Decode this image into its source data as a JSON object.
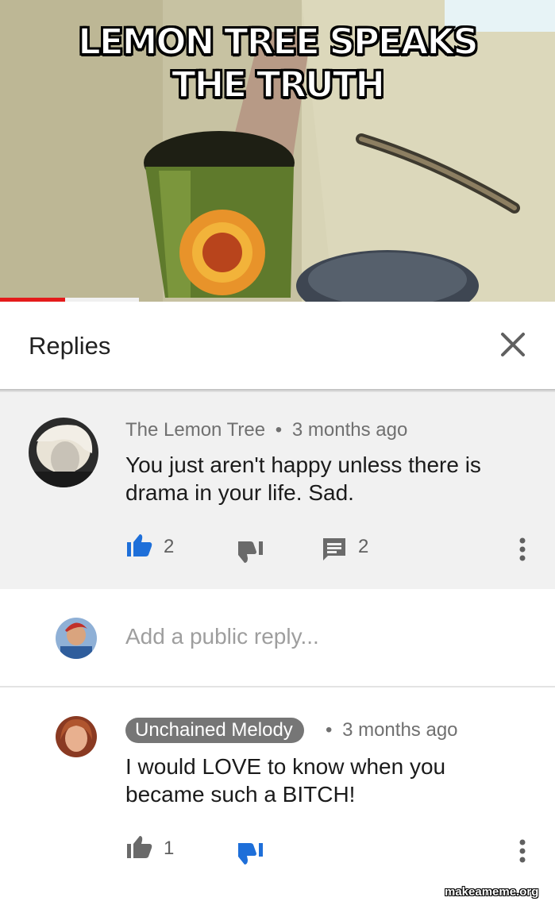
{
  "meme": {
    "caption": "LEMON TREE SPEAKS THE TRUTH",
    "watermark": "makeameme.org"
  },
  "video": {
    "progress": 0.47,
    "progress_color": "#e41b1b"
  },
  "replies_panel": {
    "title": "Replies",
    "close_icon": "close-icon"
  },
  "parent_comment": {
    "author": "The Lemon Tree",
    "separator": "•",
    "time": "3 months ago",
    "text": "You just aren't happy unless there is drama in your life.  Sad.",
    "likes": "2",
    "replies": "2",
    "liked": true,
    "like_color": "#1e6fd9",
    "icons": [
      "thumb-up-icon",
      "thumb-down-icon",
      "comment-icon",
      "more-vert-icon"
    ]
  },
  "reply_box": {
    "placeholder": "Add a public reply..."
  },
  "reply_comment": {
    "author": "Unchained Melody",
    "separator": "•",
    "time": "3 months ago",
    "text": "I would LOVE to know when you became such a BITCH!",
    "likes": "1",
    "disliked": true,
    "dislike_color": "#1e6fd9",
    "icons": [
      "thumb-up-icon",
      "thumb-down-icon",
      "more-vert-icon"
    ]
  }
}
